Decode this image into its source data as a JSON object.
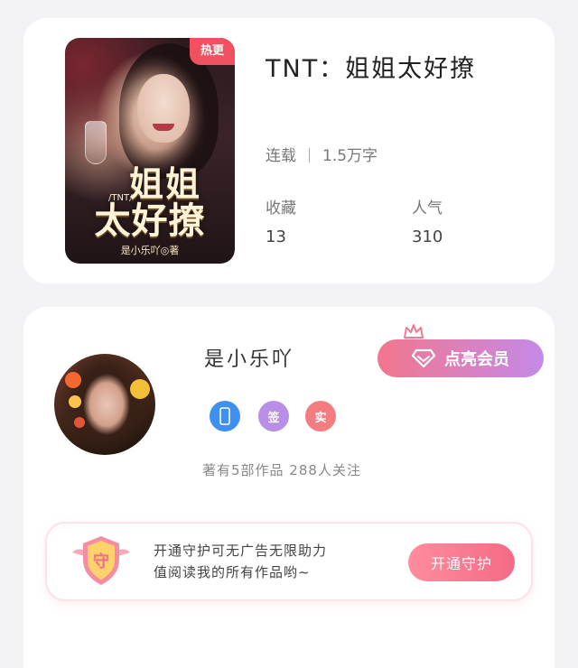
{
  "book": {
    "hot_badge": "热更",
    "title": "TNT：姐姐太好撩",
    "status": "连载",
    "word_count": "1.5万字",
    "favorites_label": "收藏",
    "favorites_value": "13",
    "popularity_label": "人气",
    "popularity_value": "310",
    "cover": {
      "tag": "/TNT/",
      "title_line1": "姐姐",
      "title_line2": "太好撩",
      "author": "是小乐吖◎著"
    }
  },
  "author": {
    "name": "是小乐吖",
    "vip_label": "点亮会员",
    "badges": [
      {
        "icon": "phone-icon",
        "text": "",
        "color": "#3f8ff0"
      },
      {
        "icon": "sign-badge",
        "text": "签",
        "color": "#b88ee6"
      },
      {
        "icon": "real-name-badge",
        "text": "实",
        "color": "#f47c80"
      }
    ],
    "stats": "著有5部作品 288人关注"
  },
  "guard": {
    "text_line1": "开通守护可无广告无限助力",
    "text_line2": "值阅读我的所有作品哟~",
    "button_label": "开通守护",
    "shield_char": "守"
  },
  "colors": {
    "accent_pink": "#f36b86",
    "vip_gradient_end": "#c48ae8",
    "hot_red": "#f0505f"
  }
}
